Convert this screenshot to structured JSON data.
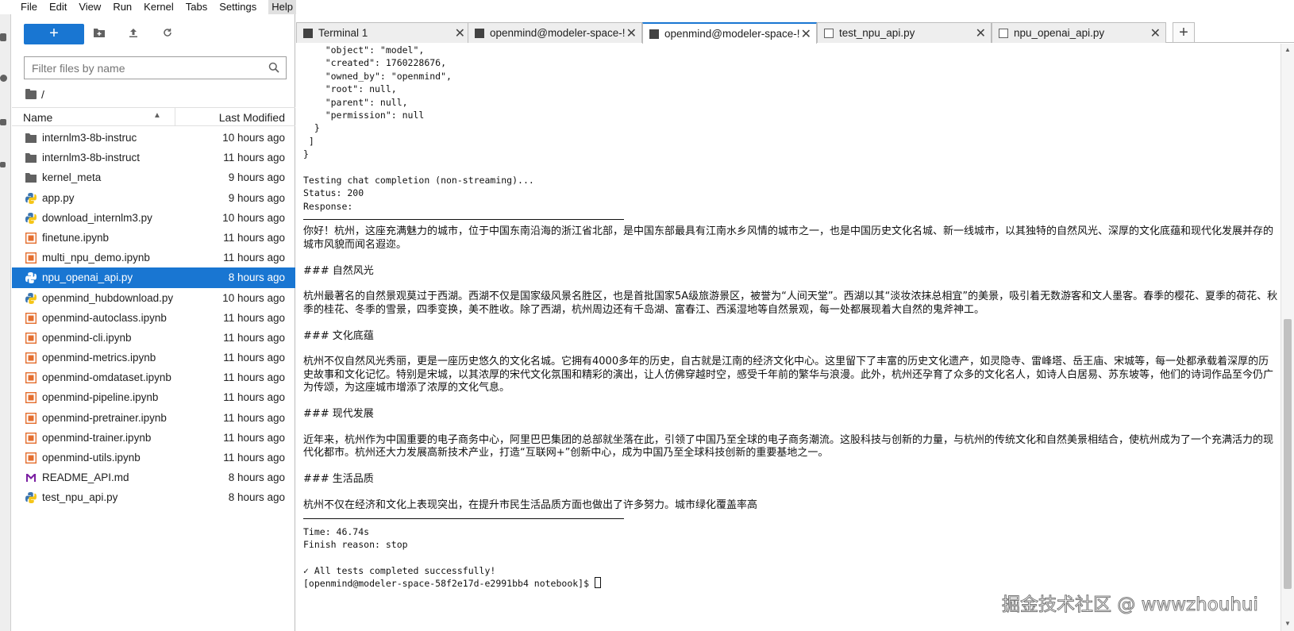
{
  "menubar": [
    "File",
    "Edit",
    "View",
    "Run",
    "Kernel",
    "Tabs",
    "Settings",
    "Help"
  ],
  "filebrowser": {
    "new_label": "+",
    "search_placeholder": "Filter files by name",
    "breadcrumb": "/",
    "header_name": "Name",
    "header_modified": "Last Modified",
    "files": [
      {
        "name": "internlm3-8b-instruc",
        "modified": "10 hours ago",
        "icon": "folder-icon"
      },
      {
        "name": "internlm3-8b-instruct",
        "modified": "11 hours ago",
        "icon": "folder-icon"
      },
      {
        "name": "kernel_meta",
        "modified": "9 hours ago",
        "icon": "folder-icon"
      },
      {
        "name": "app.py",
        "modified": "9 hours ago",
        "icon": "python-icon"
      },
      {
        "name": "download_internlm3.py",
        "modified": "10 hours ago",
        "icon": "python-icon"
      },
      {
        "name": "finetune.ipynb",
        "modified": "11 hours ago",
        "icon": "notebook-icon"
      },
      {
        "name": "multi_npu_demo.ipynb",
        "modified": "11 hours ago",
        "icon": "notebook-icon"
      },
      {
        "name": "npu_openai_api.py",
        "modified": "8 hours ago",
        "icon": "python-icon",
        "selected": true
      },
      {
        "name": "openmind_hubdownload.py",
        "modified": "10 hours ago",
        "icon": "python-icon"
      },
      {
        "name": "openmind-autoclass.ipynb",
        "modified": "11 hours ago",
        "icon": "notebook-icon"
      },
      {
        "name": "openmind-cli.ipynb",
        "modified": "11 hours ago",
        "icon": "notebook-icon"
      },
      {
        "name": "openmind-metrics.ipynb",
        "modified": "11 hours ago",
        "icon": "notebook-icon"
      },
      {
        "name": "openmind-omdataset.ipynb",
        "modified": "11 hours ago",
        "icon": "notebook-icon"
      },
      {
        "name": "openmind-pipeline.ipynb",
        "modified": "11 hours ago",
        "icon": "notebook-icon"
      },
      {
        "name": "openmind-pretrainer.ipynb",
        "modified": "11 hours ago",
        "icon": "notebook-icon"
      },
      {
        "name": "openmind-trainer.ipynb",
        "modified": "11 hours ago",
        "icon": "notebook-icon"
      },
      {
        "name": "openmind-utils.ipynb",
        "modified": "11 hours ago",
        "icon": "notebook-icon"
      },
      {
        "name": "README_API.md",
        "modified": "8 hours ago",
        "icon": "markdown-icon"
      },
      {
        "name": "test_npu_api.py",
        "modified": "8 hours ago",
        "icon": "python-icon"
      }
    ]
  },
  "tabs": [
    {
      "label": "Terminal 1",
      "current": false,
      "icon": "terminal-icon"
    },
    {
      "label": "openmind@modeler-space-!",
      "current": false,
      "icon": "terminal-icon"
    },
    {
      "label": "openmind@modeler-space-!",
      "current": true,
      "icon": "terminal-icon"
    },
    {
      "label": "test_npu_api.py",
      "current": false,
      "icon": "file-icon"
    },
    {
      "label": "npu_openai_api.py",
      "current": false,
      "icon": "file-icon"
    }
  ],
  "terminal": {
    "lines": [
      {
        "t": "    \"object\": \"model\","
      },
      {
        "t": "    \"created\": 1760228676,"
      },
      {
        "t": "    \"owned_by\": \"openmind\","
      },
      {
        "t": "    \"root\": null,"
      },
      {
        "t": "    \"parent\": null,"
      },
      {
        "t": "    \"permission\": null"
      },
      {
        "t": "  }"
      },
      {
        "t": " ]"
      },
      {
        "t": "}"
      },
      {
        "t": ""
      },
      {
        "t": "Testing chat completion (non-streaming)..."
      },
      {
        "t": "Status: 200"
      },
      {
        "t": "Response:"
      },
      {
        "t": "",
        "rule": true
      },
      {
        "t": "你好！杭州，这座充满魅力的城市，位于中国东南沿海的浙江省北部，是中国东部最具有江南水乡风情的城市之一，也是中国历史文化名城、新一线城市，以其独特的自然风光、深厚的文化底蕴和现代化发展并存的城市风貌而闻名遐迩。",
        "cn": true
      },
      {
        "t": ""
      },
      {
        "t": "### 自然风光",
        "cn": true
      },
      {
        "t": ""
      },
      {
        "t": "杭州最著名的自然景观莫过于西湖。西湖不仅是国家级风景名胜区，也是首批国家5A级旅游景区，被誉为“人间天堂”。西湖以其“淡妆浓抹总相宜”的美景，吸引着无数游客和文人墨客。春季的樱花、夏季的荷花、秋季的桂花、冬季的雪景，四季变换，美不胜收。除了西湖，杭州周边还有千岛湖、富春江、西溪湿地等自然景观，每一处都展现着大自然的鬼斧神工。",
        "cn": true
      },
      {
        "t": ""
      },
      {
        "t": "### 文化底蕴",
        "cn": true
      },
      {
        "t": ""
      },
      {
        "t": "杭州不仅自然风光秀丽，更是一座历史悠久的文化名城。它拥有4000多年的历史，自古就是江南的经济文化中心。这里留下了丰富的历史文化遗产，如灵隐寺、雷峰塔、岳王庙、宋城等，每一处都承载着深厚的历史故事和文化记忆。特别是宋城，以其浓厚的宋代文化氛围和精彩的演出，让人仿佛穿越时空，感受千年前的繁华与浪漫。此外，杭州还孕育了众多的文化名人，如诗人白居易、苏东坡等，他们的诗词作品至今仍广为传颂，为这座城市增添了浓厚的文化气息。",
        "cn": true
      },
      {
        "t": ""
      },
      {
        "t": "### 现代发展",
        "cn": true
      },
      {
        "t": ""
      },
      {
        "t": "近年来，杭州作为中国重要的电子商务中心，阿里巴巴集团的总部就坐落在此，引领了中国乃至全球的电子商务潮流。这股科技与创新的力量，与杭州的传统文化和自然美景相结合，使杭州成为了一个充满活力的现代化都市。杭州还大力发展高新技术产业，打造“互联网+”创新中心，成为中国乃至全球科技创新的重要基地之一。",
        "cn": true
      },
      {
        "t": ""
      },
      {
        "t": "### 生活品质",
        "cn": true
      },
      {
        "t": ""
      },
      {
        "t": "杭州不仅在经济和文化上表现突出，在提升市民生活品质方面也做出了许多努力。城市绿化覆盖率高",
        "cn": true
      },
      {
        "t": "",
        "rule": true
      },
      {
        "t": "Time: 46.74s"
      },
      {
        "t": "Finish reason: stop"
      },
      {
        "t": ""
      },
      {
        "t": "✓ All tests completed successfully!"
      },
      {
        "t": "[openmind@modeler-space-58f2e17d-e2991bb4 notebook]$ ",
        "prompt": true
      }
    ]
  },
  "watermark": "掘金技术社区 @ wwwzhouhui"
}
